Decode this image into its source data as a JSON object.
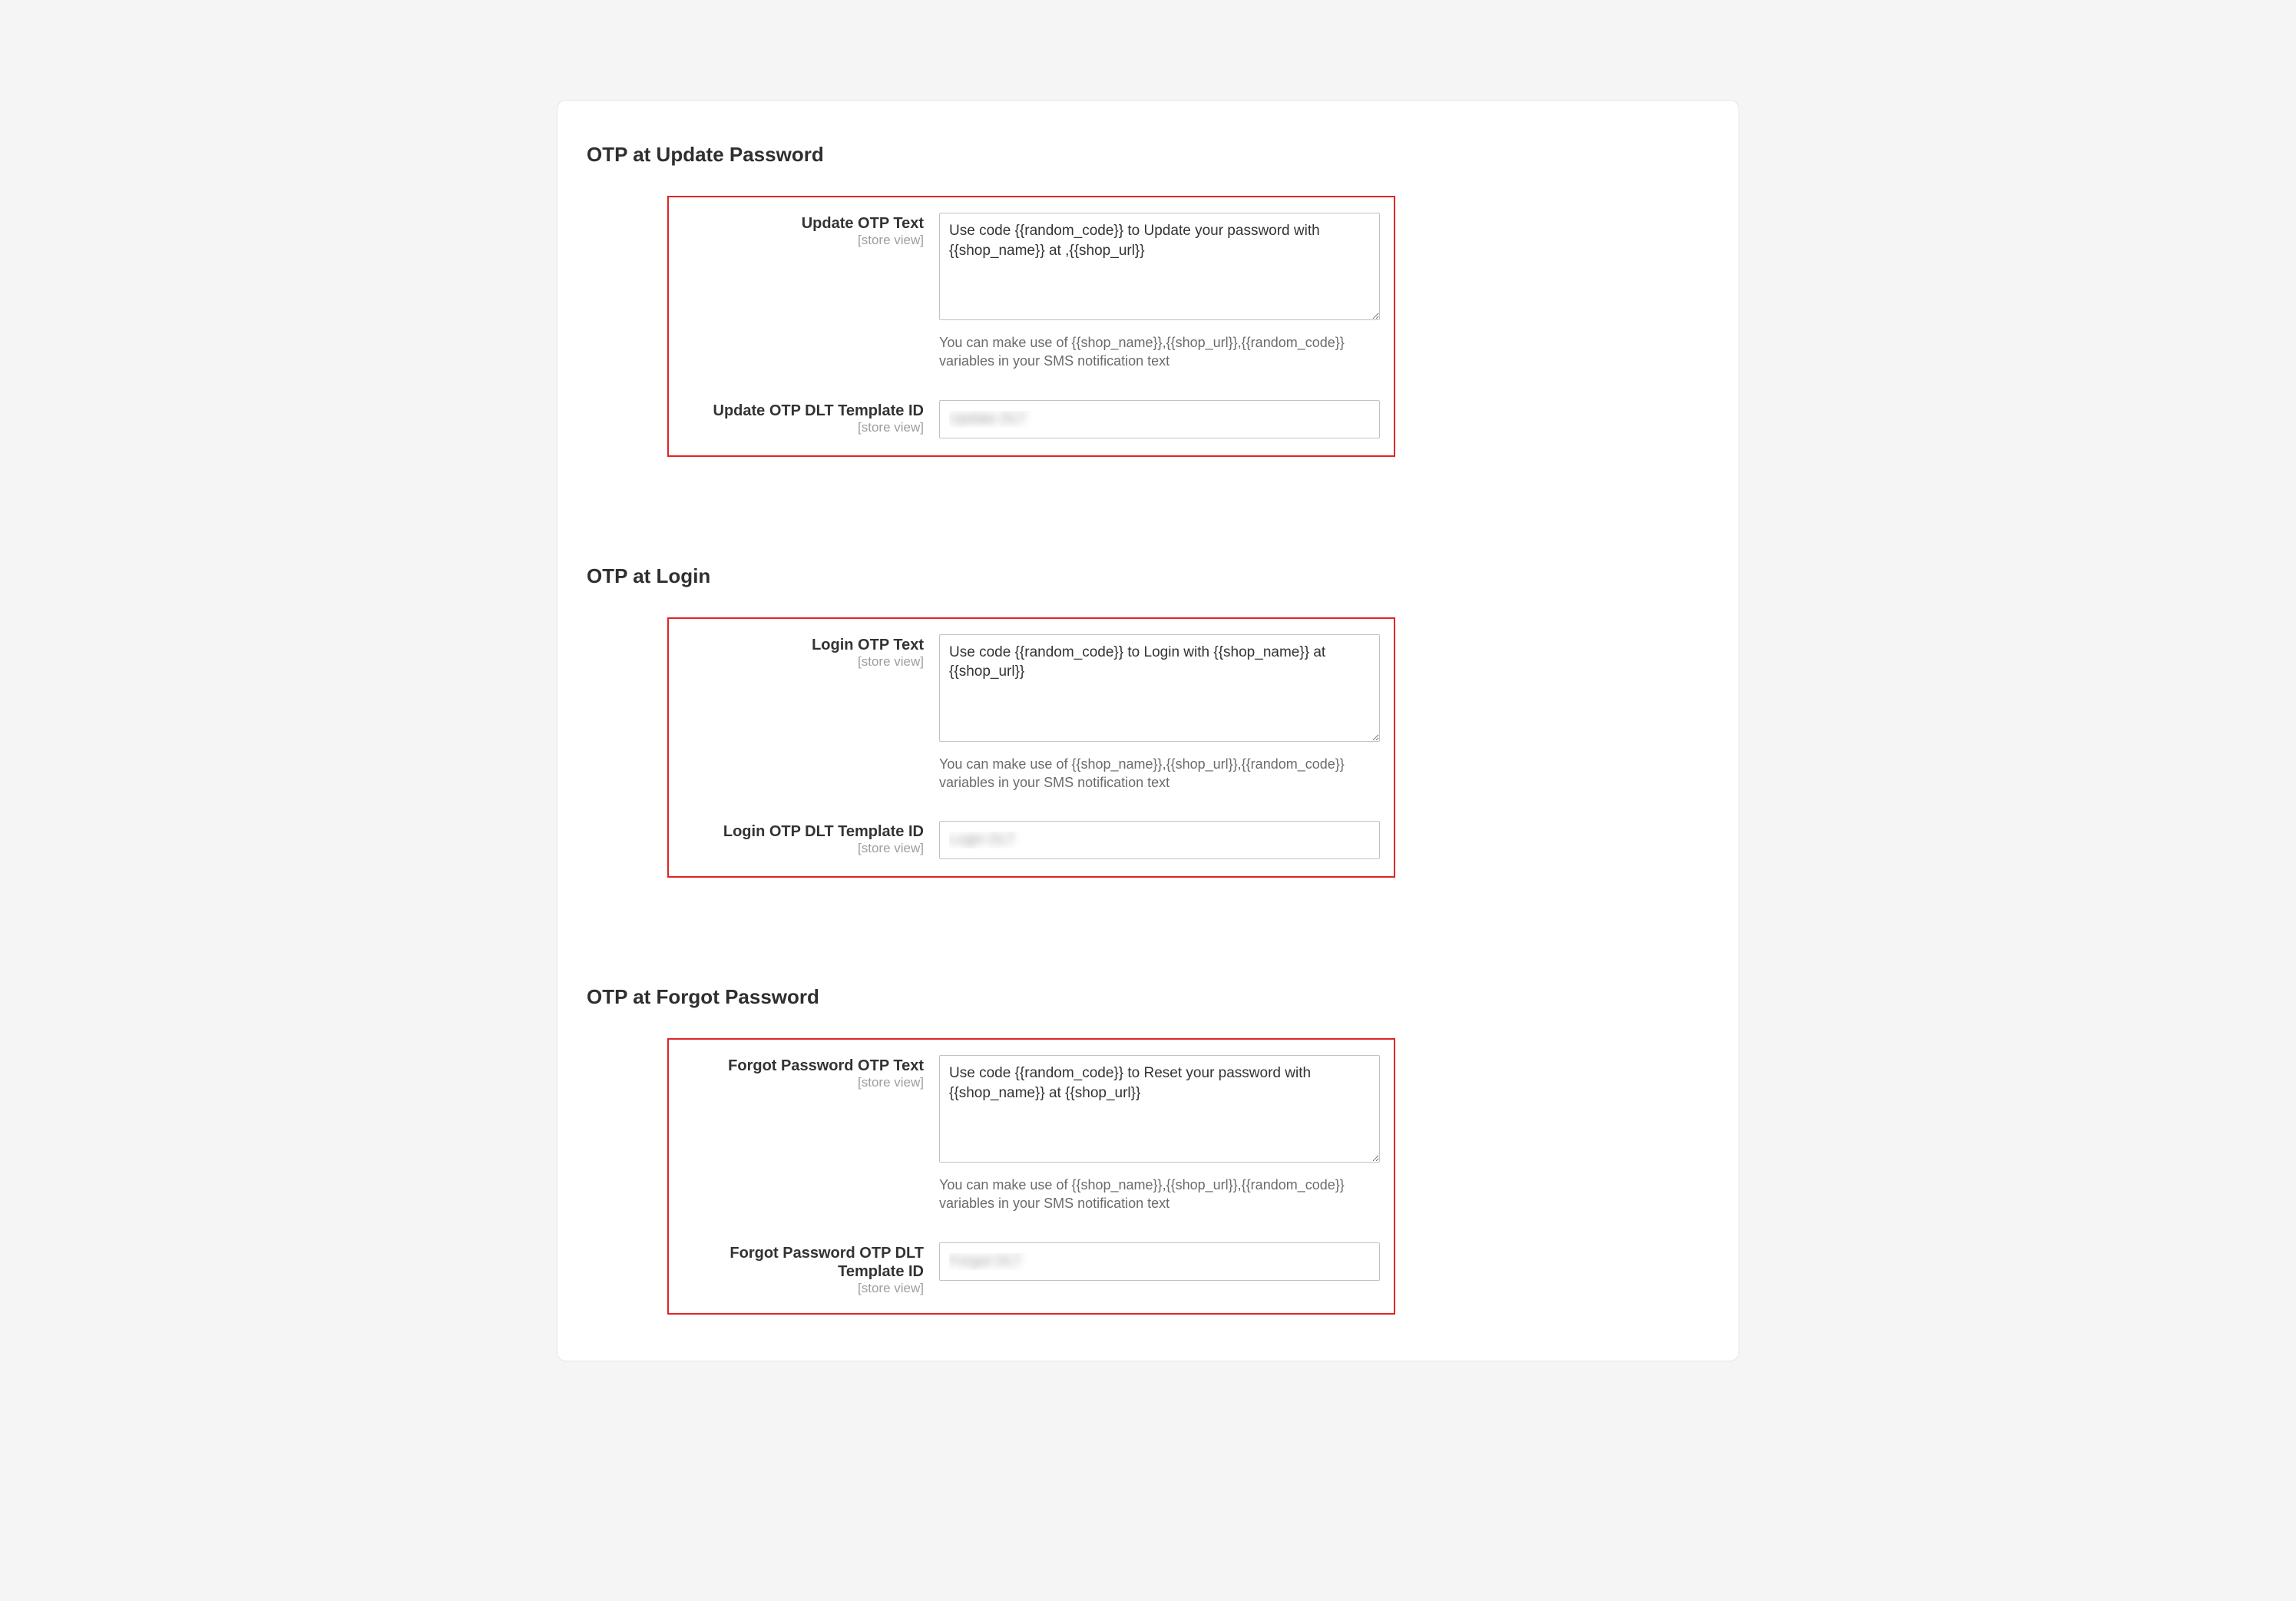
{
  "sections": {
    "update": {
      "title": "OTP at Update Password",
      "text_label": "Update OTP Text",
      "scope": "[store view]",
      "text_value": "Use code {{random_code}} to Update your password with {{shop_name}} at ,{{shop_url}}",
      "hint": "You can make use of {{shop_name}},{{shop_url}},{{random_code}} variables in your SMS notification text",
      "dlt_label": "Update OTP DLT Template ID",
      "dlt_value": "Update DLT"
    },
    "login": {
      "title": "OTP at Login",
      "text_label": "Login OTP Text",
      "scope": "[store view]",
      "text_value": "Use code {{random_code}} to Login with {{shop_name}} at {{shop_url}}",
      "hint": "You can make use of {{shop_name}},{{shop_url}},{{random_code}} variables in your SMS notification text",
      "dlt_label": "Login OTP DLT Template ID",
      "dlt_value": "Login DLT"
    },
    "forgot": {
      "title": "OTP at Forgot Password",
      "text_label": "Forgot Password OTP Text",
      "scope": "[store view]",
      "text_value": "Use code {{random_code}} to Reset your password with {{shop_name}} at {{shop_url}}",
      "hint": "You can make use of {{shop_name}},{{shop_url}},{{random_code}} variables in your SMS notification text",
      "dlt_label": "Forgot Password OTP DLT Template ID",
      "dlt_value": "Forgot DLT"
    }
  }
}
